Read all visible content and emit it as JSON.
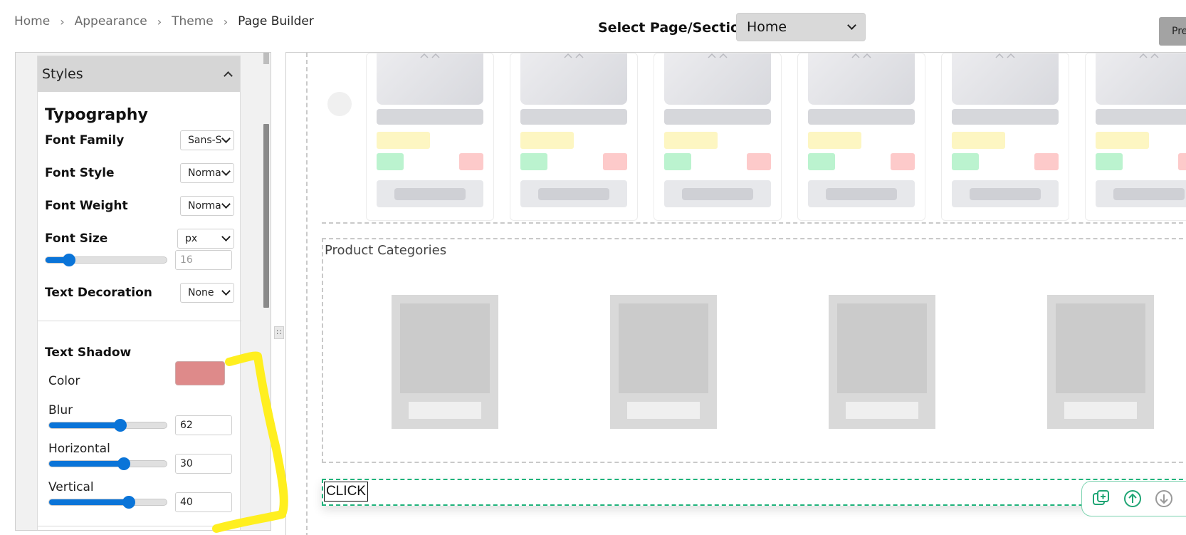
{
  "breadcrumb": {
    "items": [
      {
        "label": "Home"
      },
      {
        "label": "Appearance"
      },
      {
        "label": "Theme"
      },
      {
        "label": "Page Builder"
      }
    ]
  },
  "header": {
    "select_label": "Select Page/Section:",
    "page_select_value": "Home",
    "preview_label": "Pre"
  },
  "styles_panel": {
    "title": "Styles",
    "typography_title": "Typography",
    "font_family": {
      "label": "Font Family",
      "value": "Sans-Serif"
    },
    "font_style": {
      "label": "Font Style",
      "value": "Normal"
    },
    "font_weight": {
      "label": "Font Weight",
      "value": "Normal"
    },
    "font_size": {
      "label": "Font Size",
      "unit": "px",
      "value": "16",
      "slider_fraction": 0.16
    },
    "text_decoration": {
      "label": "Text Decoration",
      "value": "None"
    },
    "text_shadow": {
      "title": "Text Shadow",
      "color_label": "Color",
      "color": "#de8a8a",
      "blur": {
        "label": "Blur",
        "value": "62",
        "slider_fraction": 0.62
      },
      "horizontal": {
        "label": "Horizontal",
        "value": "30",
        "slider_fraction": 0.65
      },
      "vertical": {
        "label": "Vertical",
        "value": "40",
        "slider_fraction": 0.7
      }
    }
  },
  "canvas": {
    "categories_title": "Product Categories",
    "click_text": "CLICK"
  },
  "colors": {
    "accent": "#0a74d8",
    "selection_border": "#1fb37b",
    "annotation": "#ffef1f"
  }
}
